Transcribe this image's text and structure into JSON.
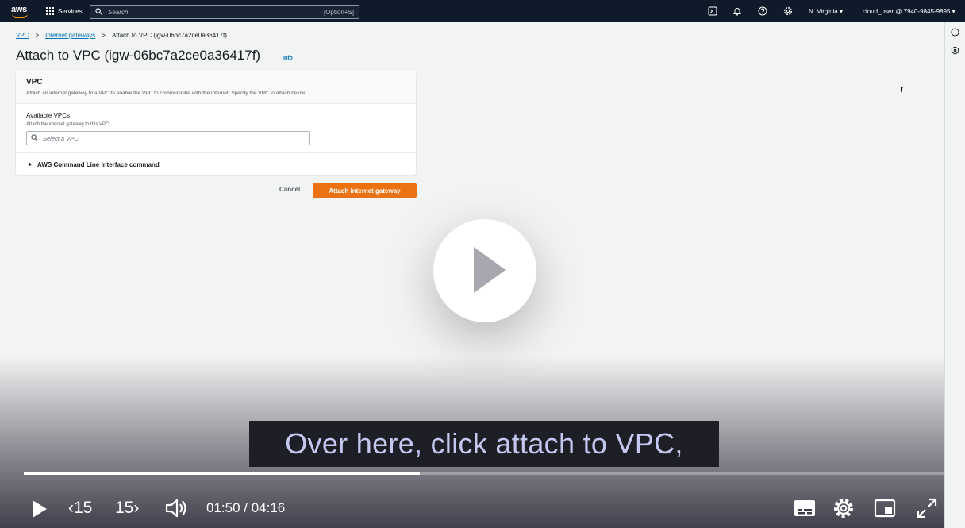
{
  "nav": {
    "logo": "aws",
    "services_label": "Services",
    "search_placeholder": "Search",
    "search_shortcut": "[Option+S]",
    "region": "N. Virginia",
    "user": "cloud_user @ 7940-9845-9895"
  },
  "breadcrumb": {
    "items": [
      "VPC",
      "Internet gateways",
      "Attach to VPC (igw-06bc7a2ce0a36417f)"
    ]
  },
  "page": {
    "title": "Attach to VPC (igw-06bc7a2ce0a36417f)",
    "info": "Info"
  },
  "panel": {
    "title": "VPC",
    "description": "Attach an internet gateway to a VPC to enable the VPC to communicate with the internet. Specify the VPC to attach below.",
    "field_label": "Available VPCs",
    "field_description": "Attach the internet gateway to this VPC.",
    "field_placeholder": "Select a VPC",
    "cli_label": "AWS Command Line Interface command"
  },
  "actions": {
    "cancel": "Cancel",
    "attach": "Attach internet gateway"
  },
  "video": {
    "caption": "Over here, click attach to VPC,",
    "current_time": "01:50",
    "duration": "04:16",
    "time_display": "01:50 / 04:16",
    "progress": 0.43,
    "skip_back": "15",
    "skip_forward": "15"
  },
  "colors": {
    "nav_bg": "#0f1b2a",
    "primary_button": "#ec7211",
    "link": "#0073bb",
    "caption_text": "#c4c7f0"
  }
}
